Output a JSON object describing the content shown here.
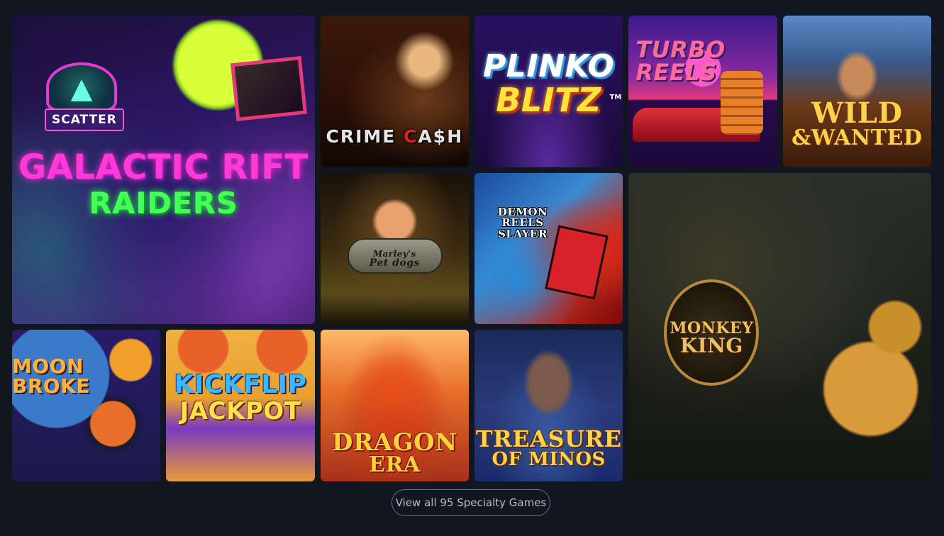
{
  "games": {
    "galactic": {
      "line1": "GALACTIC RIFT",
      "line2": "RAIDERS",
      "badge": "SCATTER"
    },
    "crime": {
      "pre": "CRIME",
      "mid": "C",
      "post": "A$H"
    },
    "plinko": {
      "line1": "PLINKO",
      "line2": "BLITZ",
      "tm": "TM"
    },
    "turbo": {
      "line1": "TURBO",
      "line2": "REELS"
    },
    "wild": {
      "line1": "WILD",
      "line2": "&WANTED"
    },
    "marley": {
      "line1": "Marley's",
      "line2": "Pet dogs"
    },
    "demon": {
      "line1": "DEMON",
      "line2": "REELS",
      "line3": "SLAYER"
    },
    "monkey": {
      "line1": "MONKEY",
      "line2": "KING"
    },
    "moon": {
      "line1": "MOON",
      "line2": "BROKE"
    },
    "kickflip": {
      "line1": "KICKFLIP",
      "line2": "JACKPOT"
    },
    "dragon": {
      "line1": "DRAGON",
      "line2": "ERA"
    },
    "minos": {
      "line1": "TREASURE",
      "line2": "OF MINOS"
    }
  },
  "footer": {
    "view_all_label": "View all 95 Specialty Games"
  },
  "colors": {
    "page_bg": "#111620",
    "button_border": "#6a7080",
    "button_text": "#b8bcc6"
  },
  "icons": {}
}
